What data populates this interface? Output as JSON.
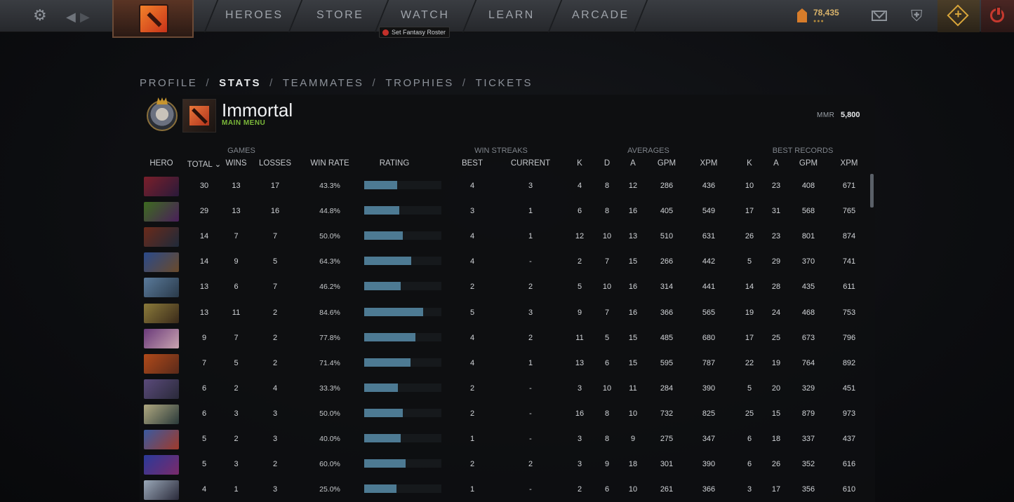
{
  "topbar": {
    "settings_icon": "gear-icon",
    "nav_items": [
      "HEROES",
      "STORE",
      "WATCH",
      "LEARN",
      "ARCADE"
    ],
    "fantasy_label": "Set Fantasy Roster",
    "gold": "78,435",
    "gold_dots": "●●●",
    "accent_color": "#d9a63a",
    "power_color": "#c6392e"
  },
  "breadcrumb": [
    "PROFILE",
    "STATS",
    "TEAMMATES",
    "TROPHIES",
    "TICKETS"
  ],
  "breadcrumb_sep": "/",
  "breadcrumb_active": "STATS",
  "profile": {
    "name": "Immortal",
    "subtitle": "MAIN MENU",
    "mmr_label": "MMR",
    "mmr_value": "5,800"
  },
  "groups": {
    "games": "GAMES",
    "win_streaks": "WIN STREAKS",
    "averages": "AVERAGES",
    "best_records": "BEST RECORDS"
  },
  "columns": {
    "hero": "HERO",
    "total": "TOTAL",
    "total_sort": "⌄",
    "wins": "WINS",
    "losses": "LOSSES",
    "win_rate": "WIN RATE",
    "rating": "RATING",
    "best": "BEST",
    "current": "CURRENT",
    "avg_k": "K",
    "avg_d": "D",
    "avg_a": "A",
    "avg_gpm": "GPM",
    "avg_xpm": "XPM",
    "best_k": "K",
    "best_a": "A",
    "best_gpm": "GPM",
    "best_xpm": "XPM"
  },
  "rows": [
    {
      "total": "30",
      "wins": "13",
      "losses": "17",
      "win_rate": "43.3%",
      "rating": 0.43,
      "best": "4",
      "current": "3",
      "avg_k": "4",
      "avg_d": "8",
      "avg_a": "12",
      "avg_gpm": "286",
      "avg_xpm": "436",
      "best_k": "10",
      "best_a": "23",
      "best_gpm": "408",
      "best_xpm": "671"
    },
    {
      "total": "29",
      "wins": "13",
      "losses": "16",
      "win_rate": "44.8%",
      "rating": 0.45,
      "best": "3",
      "current": "1",
      "avg_k": "6",
      "avg_d": "8",
      "avg_a": "16",
      "avg_gpm": "405",
      "avg_xpm": "549",
      "best_k": "17",
      "best_a": "31",
      "best_gpm": "568",
      "best_xpm": "765"
    },
    {
      "total": "14",
      "wins": "7",
      "losses": "7",
      "win_rate": "50.0%",
      "rating": 0.5,
      "best": "4",
      "current": "1",
      "avg_k": "12",
      "avg_d": "10",
      "avg_a": "13",
      "avg_gpm": "510",
      "avg_xpm": "631",
      "best_k": "26",
      "best_a": "23",
      "best_gpm": "801",
      "best_xpm": "874"
    },
    {
      "total": "14",
      "wins": "9",
      "losses": "5",
      "win_rate": "64.3%",
      "rating": 0.61,
      "best": "4",
      "current": "-",
      "avg_k": "2",
      "avg_d": "7",
      "avg_a": "15",
      "avg_gpm": "266",
      "avg_xpm": "442",
      "best_k": "5",
      "best_a": "29",
      "best_gpm": "370",
      "best_xpm": "741"
    },
    {
      "total": "13",
      "wins": "6",
      "losses": "7",
      "win_rate": "46.2%",
      "rating": 0.47,
      "best": "2",
      "current": "2",
      "avg_k": "5",
      "avg_d": "10",
      "avg_a": "16",
      "avg_gpm": "314",
      "avg_xpm": "441",
      "best_k": "14",
      "best_a": "28",
      "best_gpm": "435",
      "best_xpm": "611"
    },
    {
      "total": "13",
      "wins": "11",
      "losses": "2",
      "win_rate": "84.6%",
      "rating": 0.76,
      "best": "5",
      "current": "3",
      "avg_k": "9",
      "avg_d": "7",
      "avg_a": "16",
      "avg_gpm": "366",
      "avg_xpm": "565",
      "best_k": "19",
      "best_a": "24",
      "best_gpm": "468",
      "best_xpm": "753"
    },
    {
      "total": "9",
      "wins": "7",
      "losses": "2",
      "win_rate": "77.8%",
      "rating": 0.66,
      "best": "4",
      "current": "2",
      "avg_k": "11",
      "avg_d": "5",
      "avg_a": "15",
      "avg_gpm": "485",
      "avg_xpm": "680",
      "best_k": "17",
      "best_a": "25",
      "best_gpm": "673",
      "best_xpm": "796"
    },
    {
      "total": "7",
      "wins": "5",
      "losses": "2",
      "win_rate": "71.4%",
      "rating": 0.6,
      "best": "4",
      "current": "1",
      "avg_k": "13",
      "avg_d": "6",
      "avg_a": "15",
      "avg_gpm": "595",
      "avg_xpm": "787",
      "best_k": "22",
      "best_a": "19",
      "best_gpm": "764",
      "best_xpm": "892"
    },
    {
      "total": "6",
      "wins": "2",
      "losses": "4",
      "win_rate": "33.3%",
      "rating": 0.44,
      "best": "2",
      "current": "-",
      "avg_k": "3",
      "avg_d": "10",
      "avg_a": "11",
      "avg_gpm": "284",
      "avg_xpm": "390",
      "best_k": "5",
      "best_a": "20",
      "best_gpm": "329",
      "best_xpm": "451"
    },
    {
      "total": "6",
      "wins": "3",
      "losses": "3",
      "win_rate": "50.0%",
      "rating": 0.5,
      "best": "2",
      "current": "-",
      "avg_k": "16",
      "avg_d": "8",
      "avg_a": "10",
      "avg_gpm": "732",
      "avg_xpm": "825",
      "best_k": "25",
      "best_a": "15",
      "best_gpm": "879",
      "best_xpm": "973"
    },
    {
      "total": "5",
      "wins": "2",
      "losses": "3",
      "win_rate": "40.0%",
      "rating": 0.47,
      "best": "1",
      "current": "-",
      "avg_k": "3",
      "avg_d": "8",
      "avg_a": "9",
      "avg_gpm": "275",
      "avg_xpm": "347",
      "best_k": "6",
      "best_a": "18",
      "best_gpm": "337",
      "best_xpm": "437"
    },
    {
      "total": "5",
      "wins": "3",
      "losses": "2",
      "win_rate": "60.0%",
      "rating": 0.54,
      "best": "2",
      "current": "2",
      "avg_k": "3",
      "avg_d": "9",
      "avg_a": "18",
      "avg_gpm": "301",
      "avg_xpm": "390",
      "best_k": "6",
      "best_a": "26",
      "best_gpm": "352",
      "best_xpm": "616"
    },
    {
      "total": "4",
      "wins": "1",
      "losses": "3",
      "win_rate": "25.0%",
      "rating": 0.42,
      "best": "1",
      "current": "-",
      "avg_k": "2",
      "avg_d": "6",
      "avg_a": "10",
      "avg_gpm": "261",
      "avg_xpm": "366",
      "best_k": "3",
      "best_a": "17",
      "best_gpm": "356",
      "best_xpm": "610"
    }
  ],
  "hero_colors": [
    [
      "#7a1f2a",
      "#2a1a3a"
    ],
    [
      "#3d6b1f",
      "#4a1f5a"
    ],
    [
      "#6a2a1a",
      "#1f2a3a"
    ],
    [
      "#2a4a8a",
      "#6a4a2a"
    ],
    [
      "#5a7a9a",
      "#2a3a4a"
    ],
    [
      "#8a7a3a",
      "#3a2a1a"
    ],
    [
      "#6a3a7a",
      "#c9a4b0"
    ],
    [
      "#b04a1a",
      "#5a2a1a"
    ],
    [
      "#5a4a7a",
      "#2a2a3a"
    ],
    [
      "#b0a880",
      "#2a3a3a"
    ],
    [
      "#3a5aa0",
      "#a03a2a"
    ],
    [
      "#2a3a9a",
      "#7a2a6a"
    ],
    [
      "#9aa8b8",
      "#2a2a3a"
    ]
  ],
  "bar_color": "#4d7a93"
}
